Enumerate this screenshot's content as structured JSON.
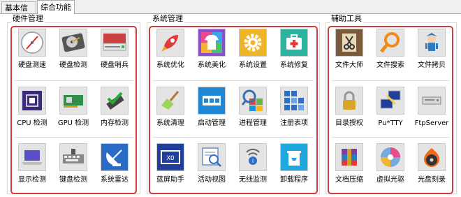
{
  "tabs": [
    {
      "label": "基本信息",
      "active": false
    },
    {
      "label": "综合功能",
      "active": true
    }
  ],
  "colors": {
    "highlight_border": "#d33a3a"
  },
  "groups": [
    {
      "title": "硬件管理",
      "items": [
        {
          "label": "硬盘测速",
          "icon": "gauge-icon"
        },
        {
          "label": "硬盘检测",
          "icon": "hard-disk-icon"
        },
        {
          "label": "硬盘哨兵",
          "icon": "disk-drive-icon"
        },
        {
          "label": "CPU 检测",
          "icon": "cpu-chip-icon"
        },
        {
          "label": "GPU 检测",
          "icon": "graphics-card-icon"
        },
        {
          "label": "内存检测",
          "icon": "memory-check-icon"
        },
        {
          "label": "显示检测",
          "icon": "laptop-display-icon"
        },
        {
          "label": "键盘检测",
          "icon": "keyboard-icon"
        },
        {
          "label": "系统雷达",
          "icon": "satellite-radar-icon"
        }
      ]
    },
    {
      "title": "系统管理",
      "items": [
        {
          "label": "系统优化",
          "icon": "rocket-icon"
        },
        {
          "label": "系统美化",
          "icon": "tshirt-icon"
        },
        {
          "label": "系统设置",
          "icon": "gear-icon"
        },
        {
          "label": "系统修复",
          "icon": "first-aid-kit-icon"
        },
        {
          "label": "系统清理",
          "icon": "broom-icon"
        },
        {
          "label": "启动管理",
          "icon": "startup-window-icon"
        },
        {
          "label": "进程管理",
          "icon": "process-search-icon"
        },
        {
          "label": "注册表项",
          "icon": "registry-grid-icon"
        },
        {
          "label": "蓝屏助手",
          "icon": "bluescreen-icon"
        },
        {
          "label": "活动视图",
          "icon": "activity-view-icon"
        },
        {
          "label": "无线监测",
          "icon": "wireless-icon"
        },
        {
          "label": "卸载程序",
          "icon": "uninstall-trash-icon"
        }
      ]
    },
    {
      "title": "辅助工具",
      "items": [
        {
          "label": "文件大师",
          "icon": "file-scissors-icon"
        },
        {
          "label": "文件搜索",
          "icon": "magnifier-icon"
        },
        {
          "label": "文件拷贝",
          "icon": "copy-character-icon"
        },
        {
          "label": "目录授权",
          "icon": "padlock-icon"
        },
        {
          "label": "Pu*TTY",
          "icon": "putty-terminal-icon"
        },
        {
          "label": "FtpServer",
          "icon": "ftp-server-icon"
        },
        {
          "label": "文档压缩",
          "icon": "archive-books-icon"
        },
        {
          "label": "虚拟光驱",
          "icon": "virtual-disc-icon"
        },
        {
          "label": "光盘刻录",
          "icon": "disc-burn-icon"
        }
      ]
    }
  ]
}
